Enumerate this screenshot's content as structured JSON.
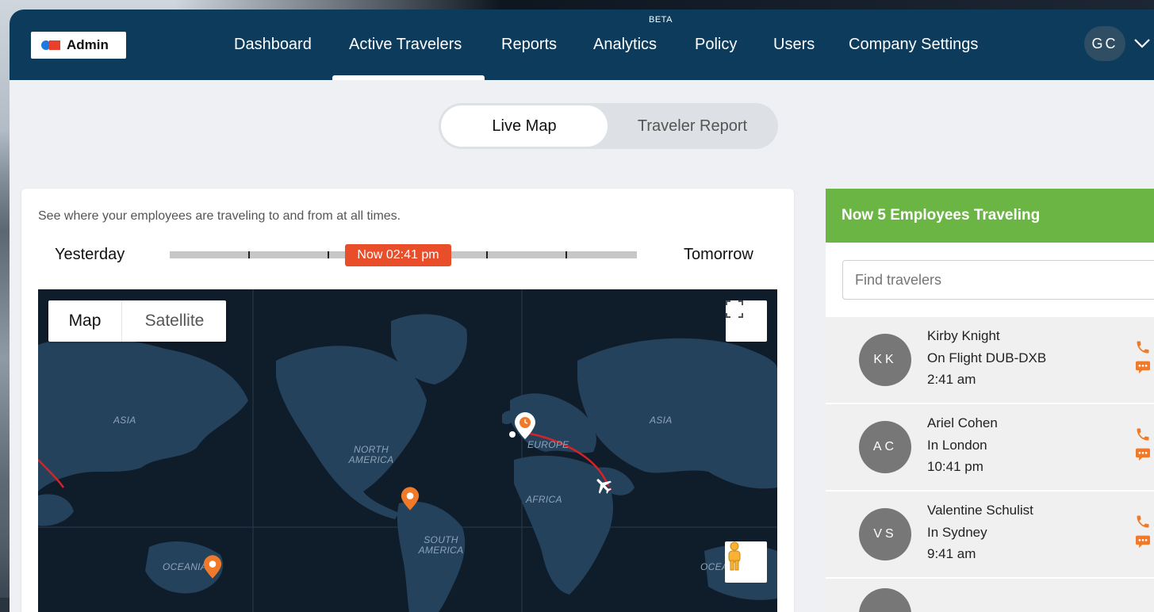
{
  "nav": {
    "logo_label": "Admin",
    "items": [
      "Dashboard",
      "Active Travelers",
      "Reports",
      "Analytics",
      "Policy",
      "Users",
      "Company Settings"
    ],
    "active": "Active Travelers",
    "beta_badge": "BETA",
    "user_initials": "GC"
  },
  "tabs": {
    "live_map": "Live Map",
    "traveler_report": "Traveler Report",
    "active": "Live Map"
  },
  "map_card": {
    "description": "See where your employees are traveling to and from at all times.",
    "timeline": {
      "left_label": "Yesterday",
      "right_label": "Tomorrow",
      "now_label": "Now 02:41 pm"
    },
    "map_type": {
      "map": "Map",
      "satellite": "Satellite",
      "selected": "Map"
    },
    "regions": {
      "asia_left": "ASIA",
      "north_america": "NORTH AMERICA",
      "europe": "EUROPE",
      "asia_right": "ASIA",
      "africa": "AFRICA",
      "south_america": "SOUTH AMERICA",
      "oceania_left": "OCEANIA",
      "oceania_right": "OCEA"
    }
  },
  "travelers_panel": {
    "header": "Now 5 Employees Traveling",
    "search_placeholder": "Find travelers",
    "travelers": [
      {
        "initials": "KK",
        "name": "Kirby Knight",
        "status": "On Flight DUB-DXB",
        "time": "2:41 am"
      },
      {
        "initials": "AC",
        "name": "Ariel Cohen",
        "status": "In London",
        "time": "10:41 pm"
      },
      {
        "initials": "VS",
        "name": "Valentine Schulist",
        "status": "In Sydney",
        "time": "9:41 am"
      }
    ]
  },
  "colors": {
    "nav_bg": "#0d3b5c",
    "panel_header": "#6ab544",
    "accent_orange": "#e94e2b",
    "route_red": "#d6232a"
  }
}
